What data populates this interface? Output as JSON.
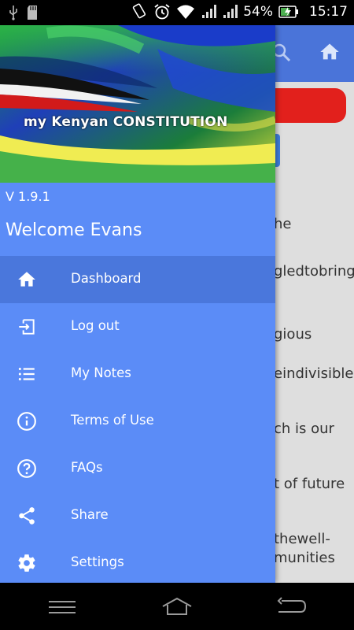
{
  "status_bar": {
    "battery_percent": "54%",
    "time": "15:17",
    "icons": [
      "usb-icon",
      "sd-card-icon",
      "rotate-icon",
      "alarm-icon",
      "wifi-icon",
      "signal-icon",
      "signal-icon",
      "battery-icon"
    ]
  },
  "background_app": {
    "visible_text_lines": [
      "he",
      "gledtobring",
      "gious",
      "eindivisible",
      "ch is our",
      "t of future",
      "thewell-",
      "munities"
    ],
    "colors": {
      "toolbar": "#4a74d9",
      "red_button": "#e2201c",
      "blue_button": "#3f7fe0"
    }
  },
  "drawer": {
    "banner_title": "my Kenyan CONSTITUTION",
    "version": "V 1.9.1",
    "welcome": "Welcome Evans",
    "colors": {
      "background": "#5b8cf7",
      "active_item": "#4a77dc"
    },
    "items": [
      {
        "label": "Dashboard",
        "icon": "home-icon",
        "active": true
      },
      {
        "label": "Log out",
        "icon": "logout-icon",
        "active": false
      },
      {
        "label": "My Notes",
        "icon": "list-icon",
        "active": false
      },
      {
        "label": "Terms of Use",
        "icon": "info-icon",
        "active": false
      },
      {
        "label": "FAQs",
        "icon": "help-icon",
        "active": false
      },
      {
        "label": "Share",
        "icon": "share-icon",
        "active": false
      },
      {
        "label": "Settings",
        "icon": "gear-icon",
        "active": false
      }
    ]
  }
}
